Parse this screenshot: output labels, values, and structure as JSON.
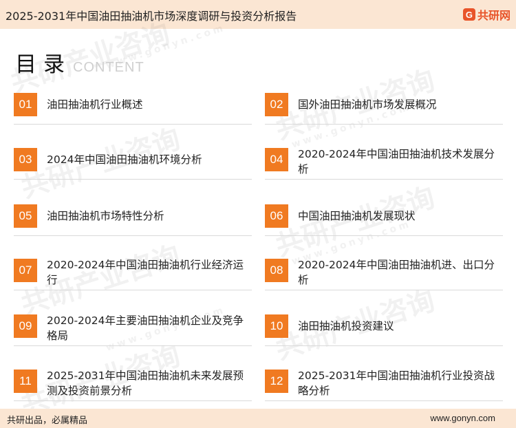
{
  "header": {
    "title": "2025-2031年中国油田抽油机市场深度调研与投资分析报告",
    "logo_text": "共研网",
    "logo_mark": "G"
  },
  "heading": {
    "cn": "目录",
    "en": "CONTENT"
  },
  "watermark": {
    "cn": "共研产业咨询",
    "url": "www.gonyn.com"
  },
  "toc": [
    {
      "num": "01",
      "label": "油田抽油机行业概述"
    },
    {
      "num": "02",
      "label": "国外油田抽油机市场发展概况"
    },
    {
      "num": "03",
      "label": "2024年中国油田抽油机环境分析"
    },
    {
      "num": "04",
      "label": "2020-2024年中国油田抽油机技术发展分析"
    },
    {
      "num": "05",
      "label": "油田抽油机市场特性分析"
    },
    {
      "num": "06",
      "label": "中国油田抽油机发展现状"
    },
    {
      "num": "07",
      "label": "2020-2024年中国油田抽油机行业经济运行"
    },
    {
      "num": "08",
      "label": "2020-2024年中国油田抽油机进、出口分析"
    },
    {
      "num": "09",
      "label": "2020-2024年主要油田抽油机企业及竞争格局"
    },
    {
      "num": "10",
      "label": "油田抽油机投资建议"
    },
    {
      "num": "11",
      "label": "2025-2031年中国油田抽油机未来发展预测及投资前景分析"
    },
    {
      "num": "12",
      "label": "2025-2031年中国油田抽油机行业投资战略分析"
    }
  ],
  "footer": {
    "left": "共研出品，必属精品",
    "right": "www.gonyn.com"
  },
  "colors": {
    "accent": "#f07a21",
    "band": "#fbe6d3",
    "logo": "#e8542a"
  }
}
